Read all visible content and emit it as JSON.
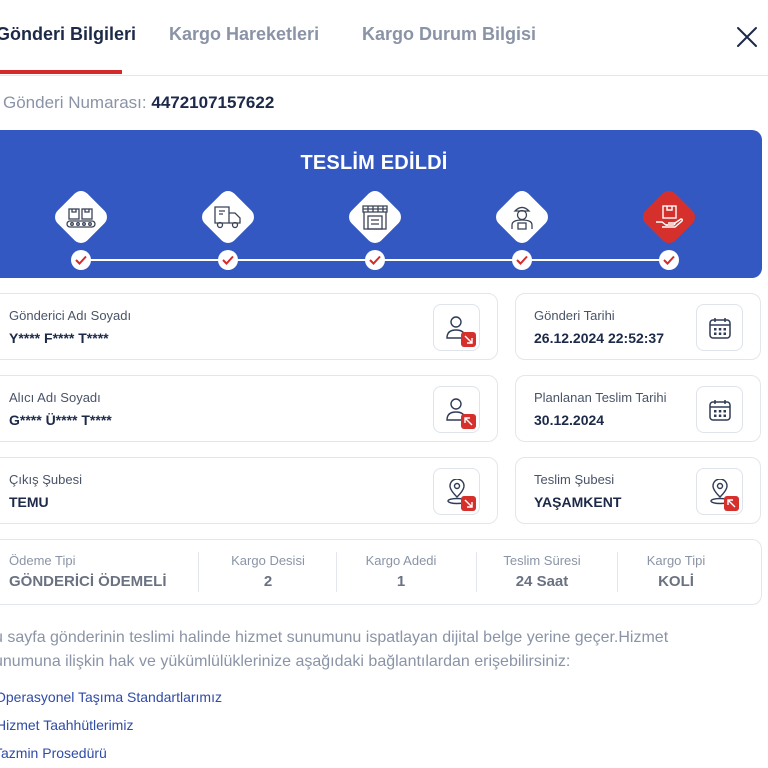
{
  "tabs": [
    {
      "label": "Gönderi Bilgileri",
      "active": true
    },
    {
      "label": "Kargo Hareketleri",
      "active": false
    },
    {
      "label": "Kargo Durum Bilgisi",
      "active": false
    }
  ],
  "shipment": {
    "number_label": "Gönderi Numarası:",
    "number_value": "4472107157622"
  },
  "status": {
    "title": "TESLİM EDİLDİ",
    "steps": [
      {
        "icon": "warehouse-conveyor-icon",
        "completed": true,
        "active": false
      },
      {
        "icon": "delivery-truck-icon",
        "completed": true,
        "active": false
      },
      {
        "icon": "branch-store-icon",
        "completed": true,
        "active": false
      },
      {
        "icon": "courier-icon",
        "completed": true,
        "active": false
      },
      {
        "icon": "package-in-hand-icon",
        "completed": true,
        "active": true
      }
    ]
  },
  "cards": {
    "sender": {
      "label": "Gönderici Adı Soyadı",
      "value": "Y**** F**** T****"
    },
    "receiver": {
      "label": "Alıcı Adı Soyadı",
      "value": "G**** Ü**** T****"
    },
    "origin_branch": {
      "label": "Çıkış Şubesi",
      "value": "TEMU"
    },
    "ship_date": {
      "label": "Gönderi Tarihi",
      "value": "26.12.2024 22:52:37"
    },
    "planned_delivery": {
      "label": "Planlanan Teslim Tarihi",
      "value": "30.12.2024"
    },
    "delivery_branch": {
      "label": "Teslim Şubesi",
      "value": "YAŞAMKENT"
    }
  },
  "summary": [
    {
      "label": "Ödeme Tipi",
      "value": "GÖNDERİCİ ÖDEMELİ"
    },
    {
      "label": "Kargo Desisi",
      "value": "2"
    },
    {
      "label": "Kargo Adedi",
      "value": "1"
    },
    {
      "label": "Teslim Süresi",
      "value": "24 Saat"
    },
    {
      "label": "Kargo Tipi",
      "value": "KOLİ"
    }
  ],
  "notice": {
    "line1": "u sayfa gönderinin teslimi halinde hizmet sunumunu ispatlayan dijital belge yerine geçer.Hizmet",
    "line2": "unumuna ilişkin hak ve yükümlülüklerinize aşağıdaki bağlantılardan erişebilirsiniz:"
  },
  "links": [
    "Operasyonel Taşıma Standartlarımız",
    "Hizmet Taahhütlerimiz",
    "Tazmin Prosedürü"
  ],
  "colors": {
    "accent_red": "#d42a2a",
    "banner_blue": "#3458c2",
    "text_dark": "#1c2948",
    "text_muted": "#8a94a6",
    "link_blue": "#2f4ba8"
  }
}
